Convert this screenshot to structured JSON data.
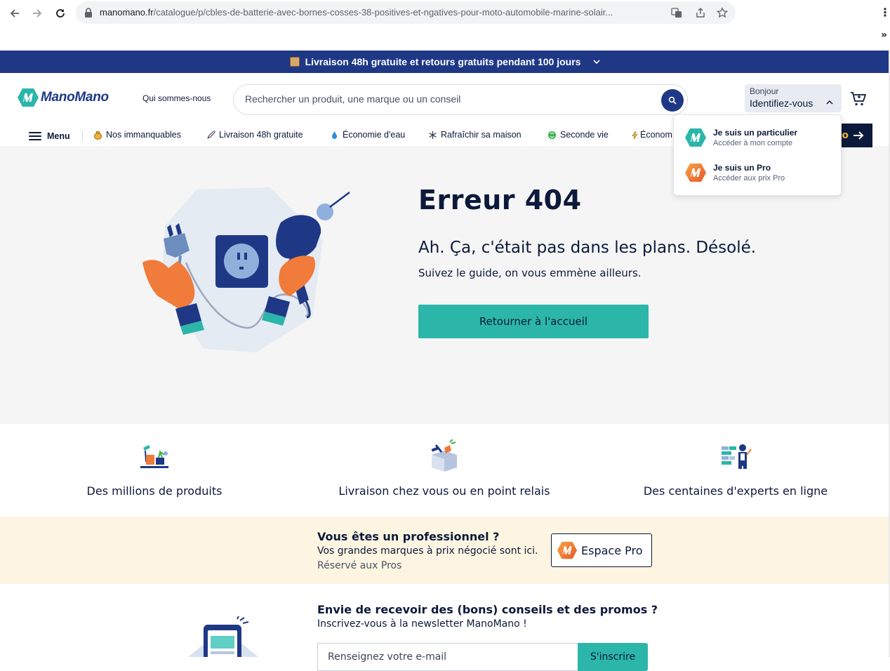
{
  "browser": {
    "url_host": "manomano.fr",
    "url_path": "/catalogue/p/cbles-de-batterie-avec-bornes-cosses-38-positives-et-ngatives-pour-moto-automobile-marine-solair..."
  },
  "banner": {
    "text": "Livraison 48h gratuite et retours gratuits pendant 100 jours"
  },
  "header": {
    "logo_text": "ManoMano",
    "about_link": "Qui sommes-nous",
    "search_placeholder": "Rechercher un produit, une marque ou un conseil",
    "account_greeting": "Bonjour",
    "account_action": "Identifiez-vous"
  },
  "category_nav": {
    "menu_label": "Menu",
    "items": [
      {
        "label": "Nos immanquables",
        "icon": "money-bag-icon"
      },
      {
        "label": "Livraison 48h gratuite",
        "icon": "rocket-icon"
      },
      {
        "label": "Économie d'eau",
        "icon": "water-drop-icon"
      },
      {
        "label": "Rafraîchir sa maison",
        "icon": "snowflake-icon"
      },
      {
        "label": "Seconde vie",
        "icon": "recycle-icon"
      },
      {
        "label": "Économ",
        "icon": "lightning-icon"
      }
    ],
    "pro_cta_text": "o"
  },
  "account_dropdown": {
    "items": [
      {
        "title": "Je suis un particulier",
        "subtitle": "Accéder à mon compte"
      },
      {
        "title": "Je suis un Pro",
        "subtitle": "Accéder aux prix Pro"
      }
    ]
  },
  "error": {
    "title": "Erreur 404",
    "subtitle": "Ah. Ça, c'était pas dans les plans. Désolé.",
    "guide": "Suivez le guide, on vous emmène ailleurs.",
    "home_button": "Retourner à l'accueil"
  },
  "features": [
    {
      "label": "Des millions de produits",
      "icon": "products-icon"
    },
    {
      "label": "Livraison chez vous ou en point relais",
      "icon": "delivery-box-icon"
    },
    {
      "label": "Des centaines d'experts en ligne",
      "icon": "expert-icon"
    }
  ],
  "pro_band": {
    "question": "Vous êtes un professionnel ?",
    "line2": "Vos grandes marques à prix négocié sont ici.",
    "line3": "Réservé aux Pros",
    "button": "Espace Pro"
  },
  "newsletter": {
    "title": "Envie de recevoir des (bons) conseils et des promos ?",
    "subtitle": "Inscrivez-vous à la newsletter ManoMano !",
    "input_placeholder": "Renseignez votre e-mail",
    "button": "S'inscrire"
  },
  "colors": {
    "brand_navy": "#1f3886",
    "brand_teal": "#2bb6a9",
    "pro_orange": "#f07b3a",
    "pro_band_bg": "#fdf5e1"
  }
}
